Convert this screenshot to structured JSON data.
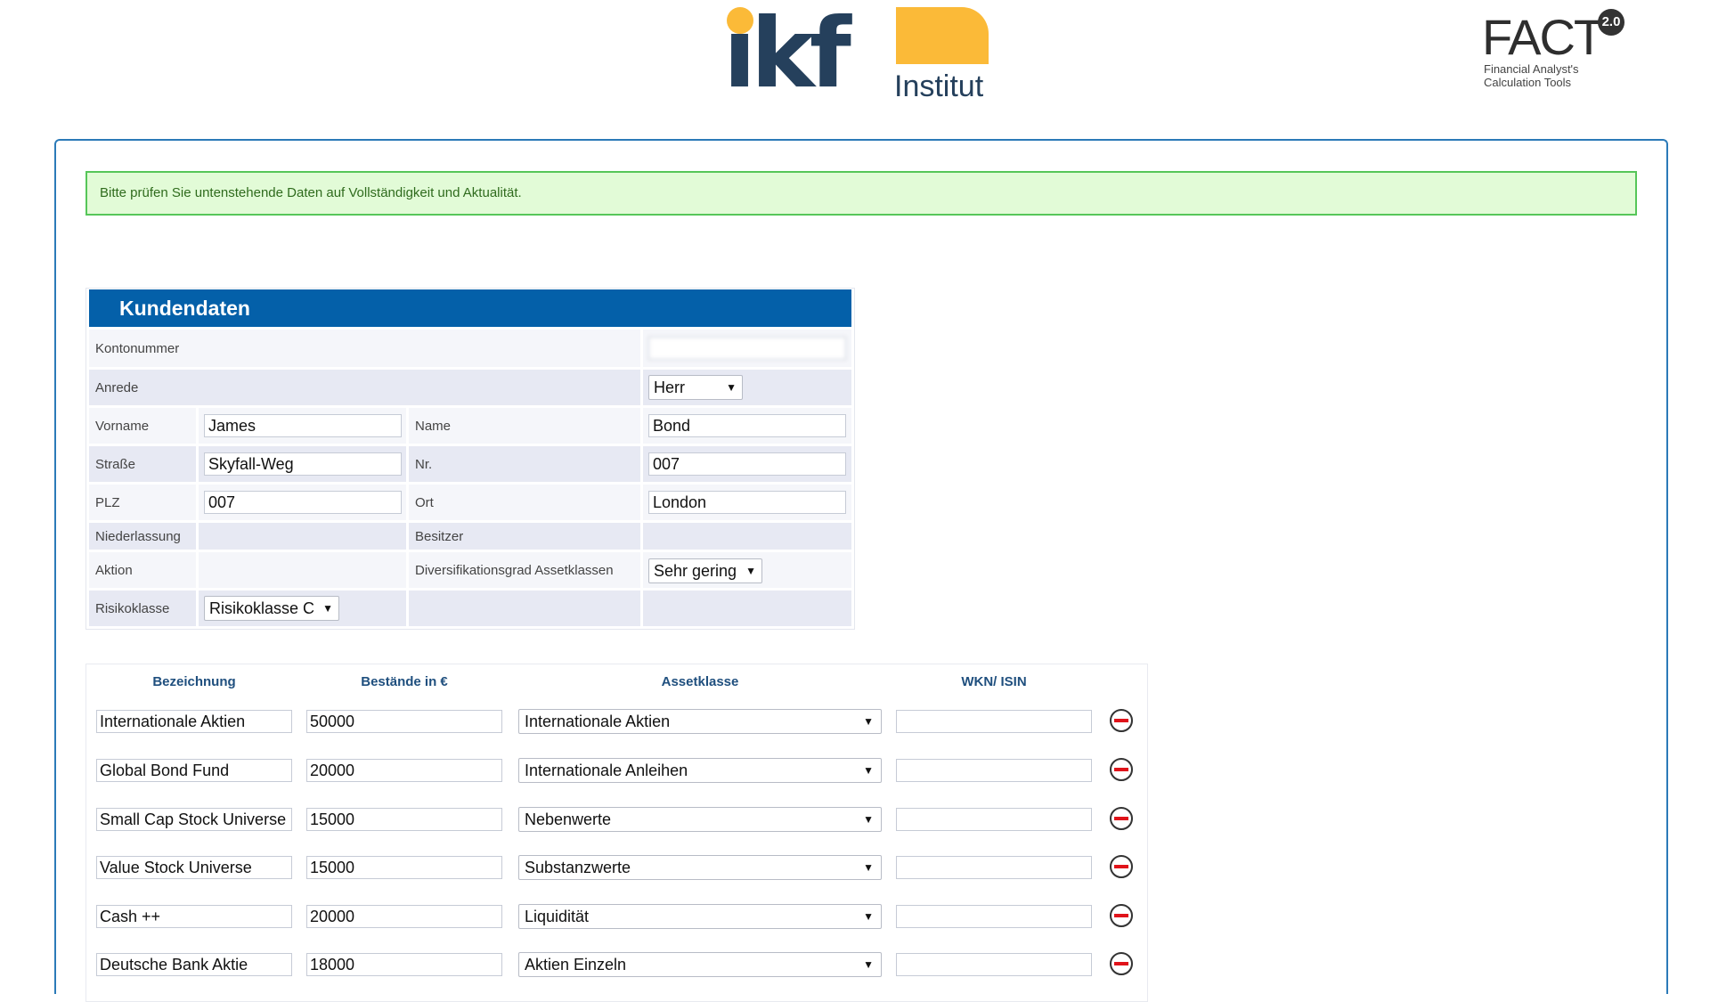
{
  "logos": {
    "ikf": {
      "word": "ikf",
      "subtitle": "Institut"
    },
    "fact": {
      "word": "FACT",
      "badge": "2.0",
      "subtitle_line1": "Financial Analyst's",
      "subtitle_line2": "Calculation Tools"
    }
  },
  "notice": "Bitte prüfen Sie untenstehende Daten auf Vollständigkeit und Aktualität.",
  "customer": {
    "title": "Kundendaten",
    "kontonummer_label": "Kontonummer",
    "kontonummer_value": "",
    "anrede_label": "Anrede",
    "anrede_value": "Herr",
    "vorname_label": "Vorname",
    "vorname_value": "James",
    "name_label": "Name",
    "name_value": "Bond",
    "strasse_label": "Straße",
    "strasse_value": "Skyfall-Weg",
    "nr_label": "Nr.",
    "nr_value": "007",
    "plz_label": "PLZ",
    "plz_value": "007",
    "ort_label": "Ort",
    "ort_value": "London",
    "niederlassung_label": "Niederlassung",
    "besitzer_label": "Besitzer",
    "besitzer_value": "",
    "aktion_label": "Aktion",
    "diversifikation_label": "Diversifikationsgrad Assetklassen",
    "diversifikation_value": "Sehr gering",
    "risikoklasse_label": "Risikoklasse",
    "risikoklasse_value": "Risikoklasse C"
  },
  "holdings": {
    "headers": {
      "bezeichnung": "Bezeichnung",
      "bestaende": "Bestände in €",
      "assetklasse": "Assetklasse",
      "wkn": "WKN/ ISIN"
    },
    "rows": [
      {
        "name": "Internationale Aktien",
        "amount": "50000",
        "asset": "Internationale Aktien",
        "wkn": ""
      },
      {
        "name": "Global Bond Fund",
        "amount": "20000",
        "asset": "Internationale Anleihen",
        "wkn": ""
      },
      {
        "name": "Small Cap Stock Universe",
        "amount": "15000",
        "asset": "Nebenwerte",
        "wkn": ""
      },
      {
        "name": "Value Stock Universe",
        "amount": "15000",
        "asset": "Substanzwerte",
        "wkn": ""
      },
      {
        "name": "Cash ++",
        "amount": "20000",
        "asset": "Liquidität",
        "wkn": ""
      },
      {
        "name": "Deutsche Bank Aktie",
        "amount": "18000",
        "asset": "Aktien Einzeln",
        "wkn": ""
      }
    ]
  },
  "icons": {
    "remove": "remove-circle-icon",
    "dropdown": "dropdown-arrow-icon"
  },
  "colors": {
    "header_blue": "#0460a9",
    "panel_border": "#2b7ab8",
    "notice_bg": "#e2fbd7",
    "notice_border": "#56c659",
    "logo_navy": "#25405c",
    "logo_yellow": "#fbba38",
    "remove_red": "#e0131a"
  }
}
